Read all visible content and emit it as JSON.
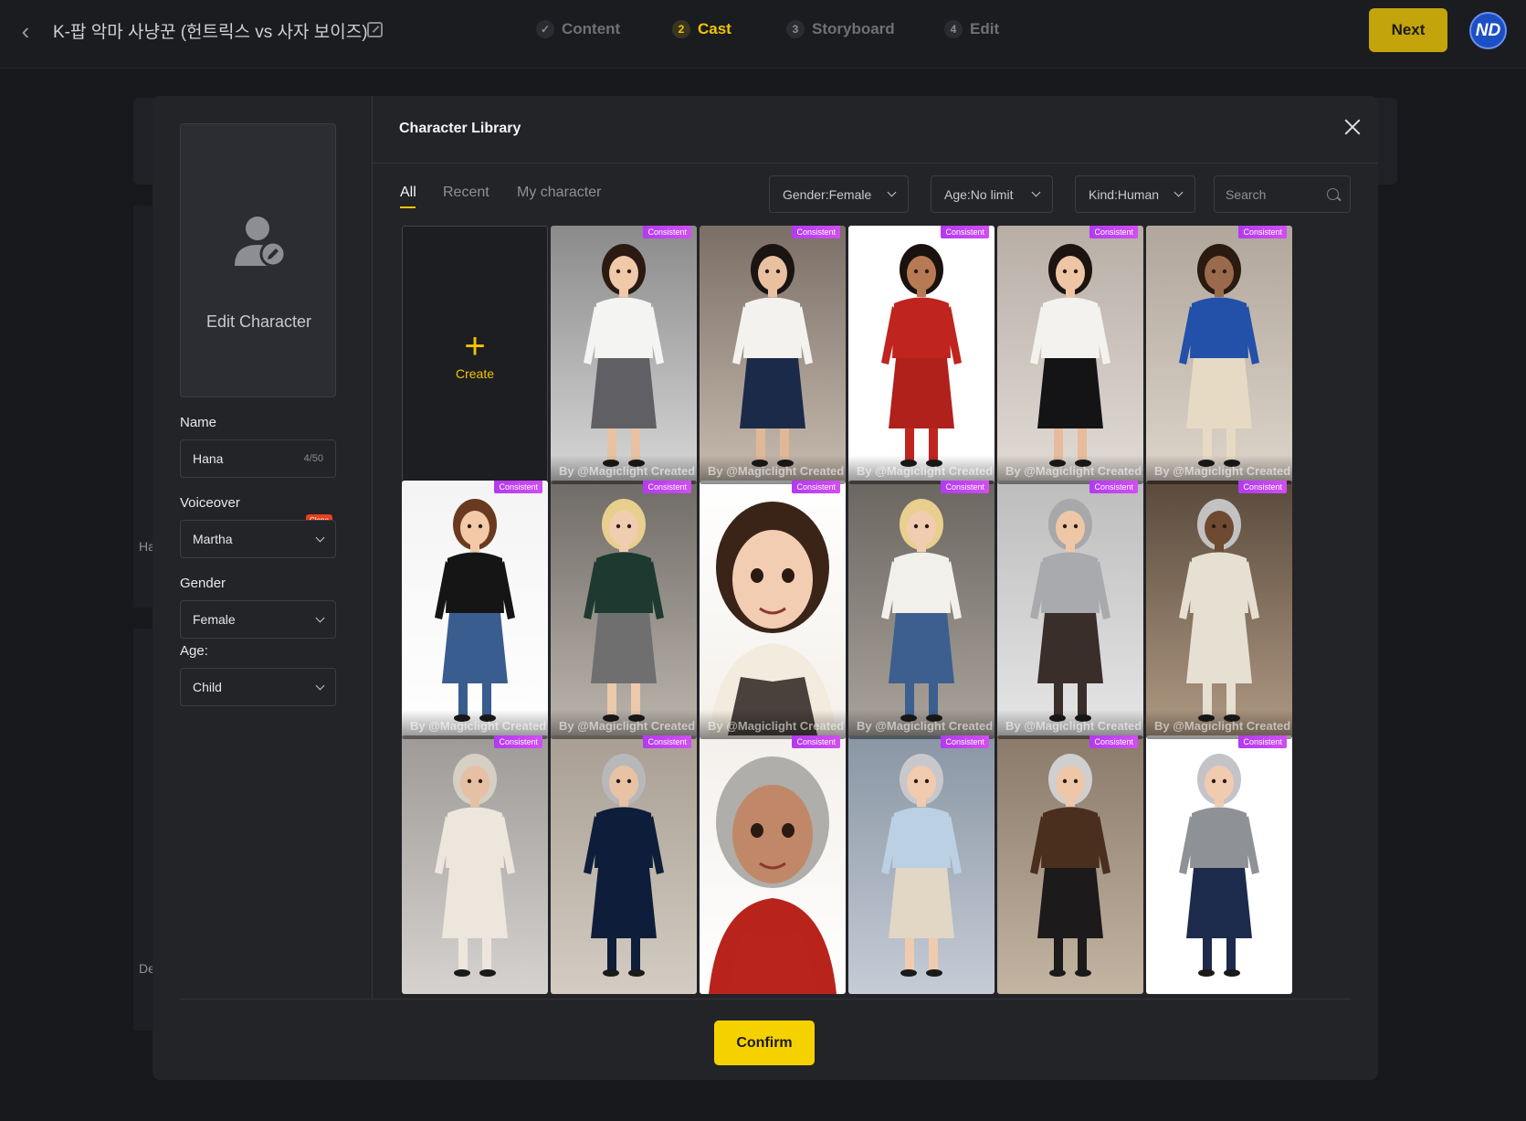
{
  "topbar": {
    "project_title": "K-팝 악마 사냥꾼 (헌트릭스 vs 사자 보이즈)",
    "steps": [
      {
        "num": "✓",
        "label": "Content"
      },
      {
        "num": "2",
        "label": "Cast"
      },
      {
        "num": "3",
        "label": "Storyboard"
      },
      {
        "num": "4",
        "label": "Edit"
      }
    ],
    "active_step": "Cast",
    "next_label": "Next",
    "avatar_initials": "ND",
    "accent": "#f2c500"
  },
  "background": {
    "card1_label": "Ha",
    "card2_label": "De"
  },
  "modal": {
    "title": "Character Library",
    "edit_character_label": "Edit Character",
    "name": {
      "label": "Name",
      "value": "Hana",
      "count": "4/50"
    },
    "voiceover": {
      "label": "Voiceover",
      "value": "Martha",
      "badge": "Clone"
    },
    "gender": {
      "label": "Gender",
      "value": "Female"
    },
    "age": {
      "label": "Age:",
      "value": "Child"
    },
    "tabs": [
      "All",
      "Recent",
      "My character"
    ],
    "active_tab": "All",
    "filters": {
      "gender": "Gender:Female",
      "age": "Age:No limit",
      "kind": "Kind:Human"
    },
    "search_placeholder": "Search",
    "create_label": "Create",
    "badge_label": "Consistent",
    "byline": "By @Magiclight Created",
    "confirm_label": "Confirm"
  },
  "characters": [
    {
      "icon": "character-young-woman-white-blouse-grey-skirt"
    },
    {
      "icon": "character-young-woman-navy-skirt"
    },
    {
      "icon": "character-young-woman-red-outfit"
    },
    {
      "icon": "character-young-woman-black-skirt"
    },
    {
      "icon": "character-young-woman-blue-top-wide-pants"
    },
    {
      "icon": "character-girl-black-tee-jeans"
    },
    {
      "icon": "character-blonde-woman-green-sweater"
    },
    {
      "icon": "character-woman-cream-blouse-portrait"
    },
    {
      "icon": "character-blonde-woman-jeans"
    },
    {
      "icon": "character-elderly-woman-grey-sweater"
    },
    {
      "icon": "character-elderly-woman-white-robe"
    },
    {
      "icon": "character-elderly-woman-white-hijab"
    },
    {
      "icon": "character-elderly-woman-navy-embroidered-dress"
    },
    {
      "icon": "character-elderly-woman-red-sari-portrait"
    },
    {
      "icon": "character-elderly-woman-light-blue-cardigan"
    },
    {
      "icon": "character-elderly-woman-brown-cardigan"
    },
    {
      "icon": "character-elderly-woman-grey-sweater-navy-skirt"
    }
  ]
}
